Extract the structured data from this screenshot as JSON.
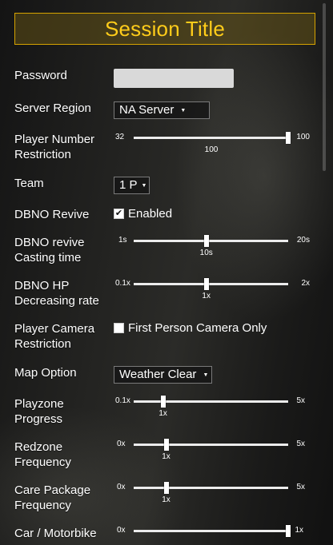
{
  "header": {
    "title": "Session Title"
  },
  "password": {
    "label": "Password",
    "value": ""
  },
  "server_region": {
    "label": "Server Region",
    "value": "NA Server"
  },
  "player_number": {
    "label": "Player Number\nRestriction",
    "min": "32",
    "max": "100",
    "value": "100",
    "fraction": 1.0
  },
  "team": {
    "label": "Team",
    "value": "1 P"
  },
  "dbno_revive": {
    "label": "DBNO Revive",
    "checkbox_label": "Enabled",
    "checked": true
  },
  "dbno_casting": {
    "label": "DBNO revive\nCasting time",
    "min": "1s",
    "max": "20s",
    "value": "10s",
    "fraction": 0.47
  },
  "dbno_hp": {
    "label": "DBNO HP\nDecreasing rate",
    "min": "0.1x",
    "max": "2x",
    "value": "1x",
    "fraction": 0.47
  },
  "camera": {
    "label": "Player Camera\nRestriction",
    "checkbox_label": "First Person Camera Only",
    "checked": false
  },
  "map_option": {
    "label": "Map Option",
    "value": "Weather Clear"
  },
  "playzone": {
    "label": "Playzone\nProgress",
    "min": "0.1x",
    "max": "5x",
    "value": "1x",
    "fraction": 0.19
  },
  "redzone": {
    "label": "Redzone\nFrequency",
    "min": "0x",
    "max": "5x",
    "value": "1x",
    "fraction": 0.21
  },
  "care_package": {
    "label": "Care Package\nFrequency",
    "min": "0x",
    "max": "5x",
    "value": "1x",
    "fraction": 0.21
  },
  "car_motorbike": {
    "label": "Car / Motorbike",
    "min": "0x",
    "max": "1x",
    "fraction": 1.0
  }
}
